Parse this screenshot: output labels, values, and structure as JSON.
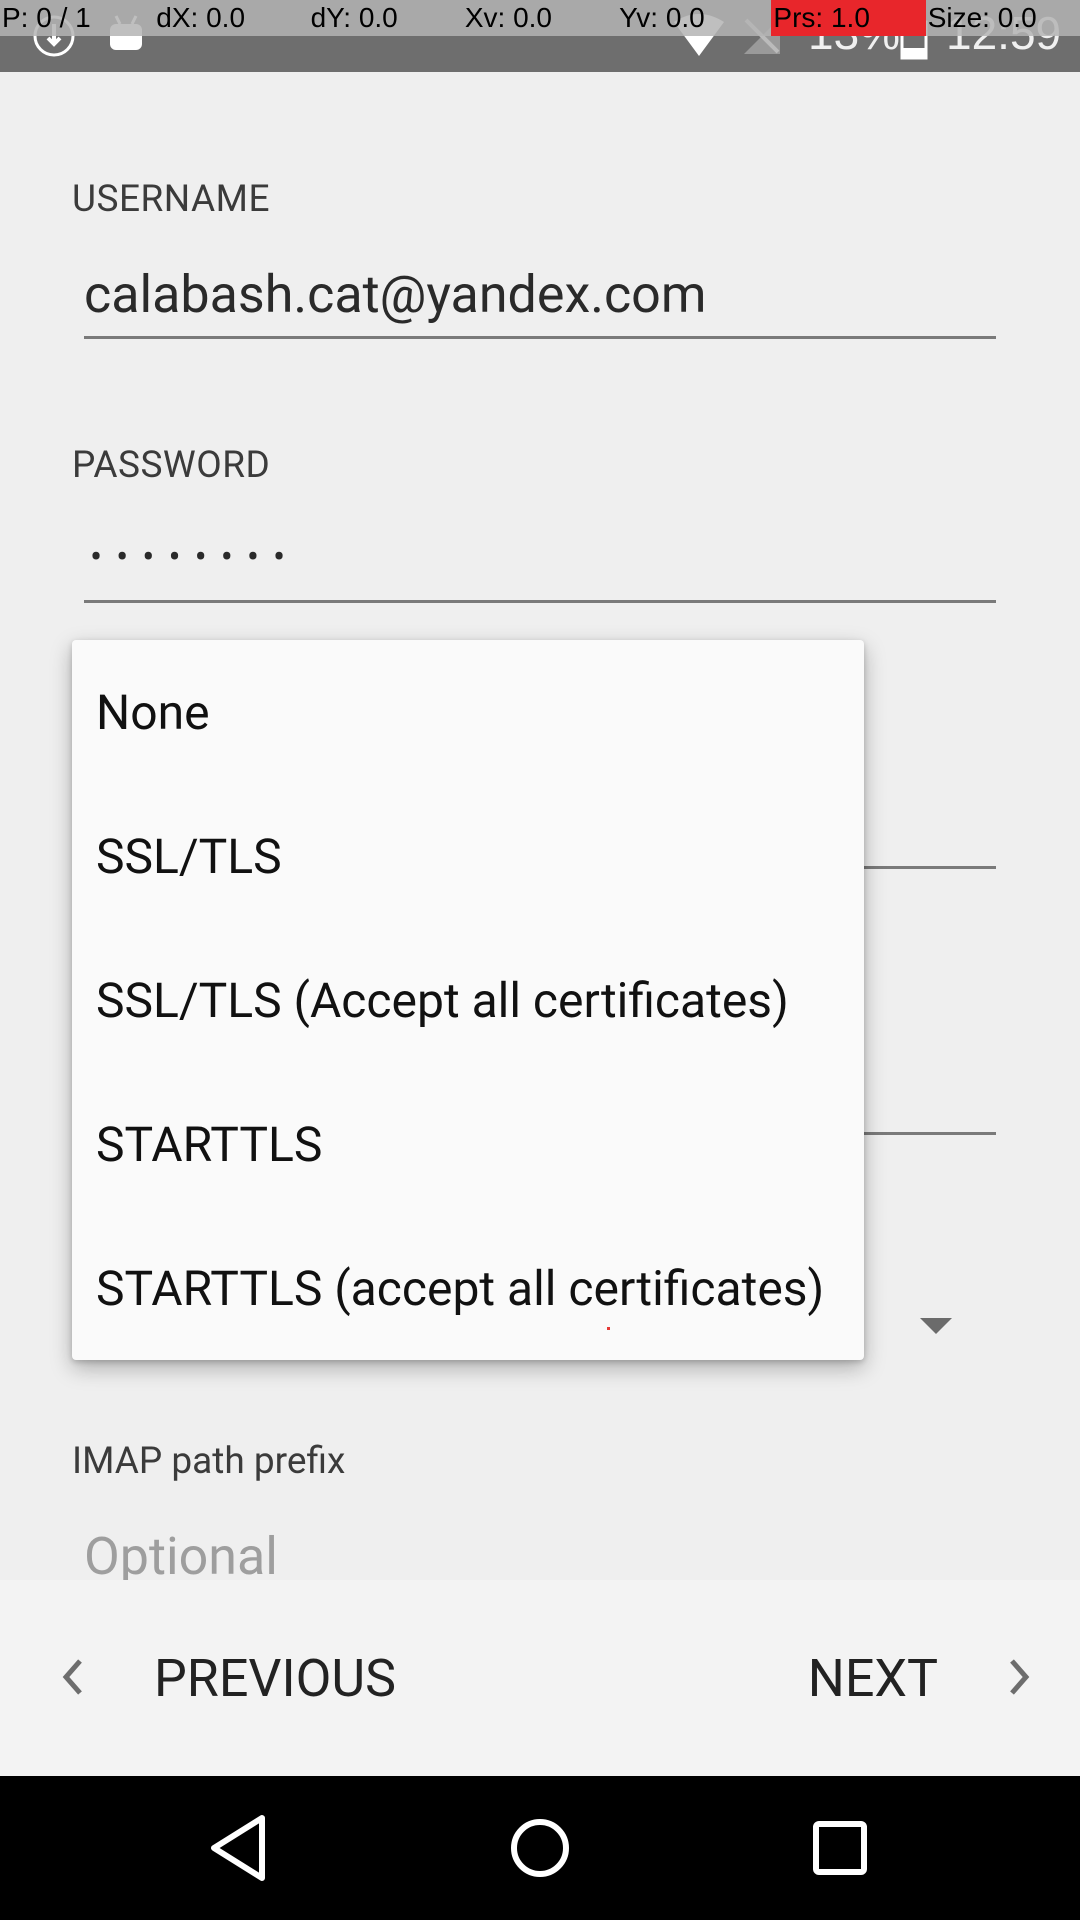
{
  "status_bar": {
    "battery": "13%",
    "time": "12:59",
    "pointer_overlay": [
      "P: 0 / 1",
      "dX: 0.0",
      "dY: 0.0",
      "Xv: 0.0",
      "Yv: 0.0",
      "Prs: 1.0",
      "Size: 0.0"
    ]
  },
  "form": {
    "username_label": "USERNAME",
    "username_value": "calabash.cat@yandex.com",
    "password_label": "PASSWORD",
    "password_mask": "••••••••",
    "imap_prefix_label": "IMAP path prefix",
    "imap_prefix_placeholder": "Optional"
  },
  "security_dropdown": {
    "options": [
      "None",
      "SSL/TLS",
      "SSL/TLS (Accept all certificates)",
      "STARTTLS",
      "STARTTLS (accept all certificates)"
    ]
  },
  "buttons": {
    "previous": "PREVIOUS",
    "next": "NEXT"
  },
  "icons": {
    "status_left": [
      "vpn-key-icon",
      "android-debug-icon"
    ],
    "status_right": [
      "wifi-icon",
      "no-signal-icon",
      "battery-charging-icon"
    ],
    "nav": [
      "back-icon",
      "home-icon",
      "recents-icon"
    ]
  }
}
